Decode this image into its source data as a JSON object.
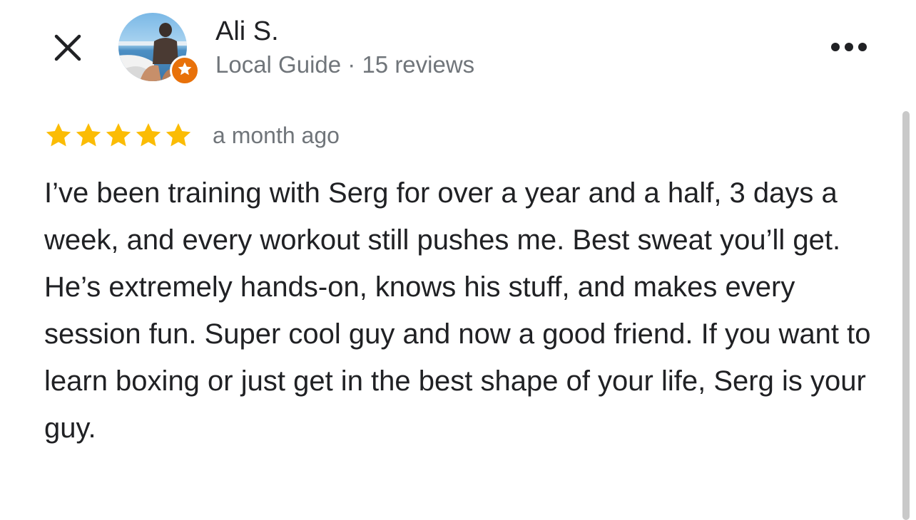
{
  "header": {
    "close_icon": "close-icon",
    "more_icon": "more-horizontal-icon"
  },
  "author": {
    "name": "Ali S.",
    "meta": "Local Guide · 15 reviews",
    "badge_icon": "local-guide-star-icon",
    "badge_color": "#e8710a"
  },
  "review": {
    "rating": 5,
    "max_rating": 5,
    "star_color": "#fbbc04",
    "date": "a month ago",
    "text": "I’ve been training with Serg for over a year and a half, 3 days a week, and every workout still pushes me. Best sweat you’ll get. He’s extremely hands-on, knows his stuff, and makes every session fun. Super cool guy and now a good friend. If you want to learn boxing or just get in the best shape of your life, Serg is your guy."
  }
}
